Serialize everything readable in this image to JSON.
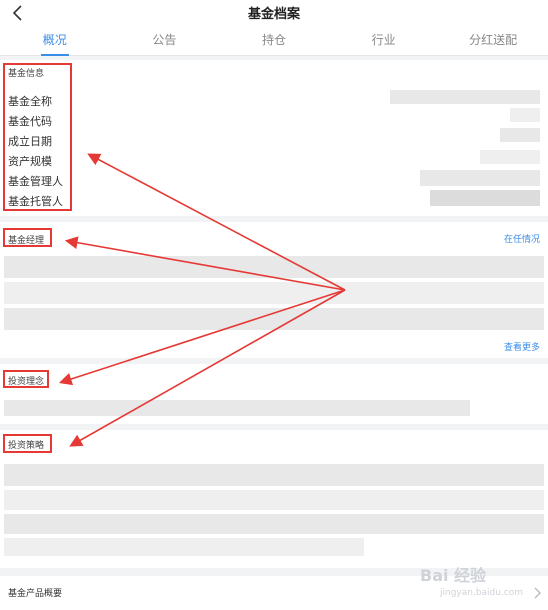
{
  "header": {
    "title": "基金档案"
  },
  "tabs": [
    {
      "label": "概况",
      "active": true
    },
    {
      "label": "公告",
      "active": false
    },
    {
      "label": "持仓",
      "active": false
    },
    {
      "label": "行业",
      "active": false
    },
    {
      "label": "分红送配",
      "active": false
    }
  ],
  "fund_info": {
    "heading": "基金信息",
    "rows": [
      "基金全称",
      "基金代码",
      "成立日期",
      "资产规模",
      "基金管理人",
      "基金托管人"
    ]
  },
  "manager": {
    "heading": "基金经理",
    "tenure_link": "在任情况",
    "more_link": "查看更多"
  },
  "philosophy": {
    "heading": "投资理念"
  },
  "strategy": {
    "heading": "投资策略"
  },
  "footer": {
    "label": "基金产品概要"
  },
  "watermark": {
    "text": "Bai 经验",
    "sub": "jingyan.baidu.com"
  },
  "colors": {
    "accent": "#3b8ee8",
    "annotation": "#e53935"
  }
}
